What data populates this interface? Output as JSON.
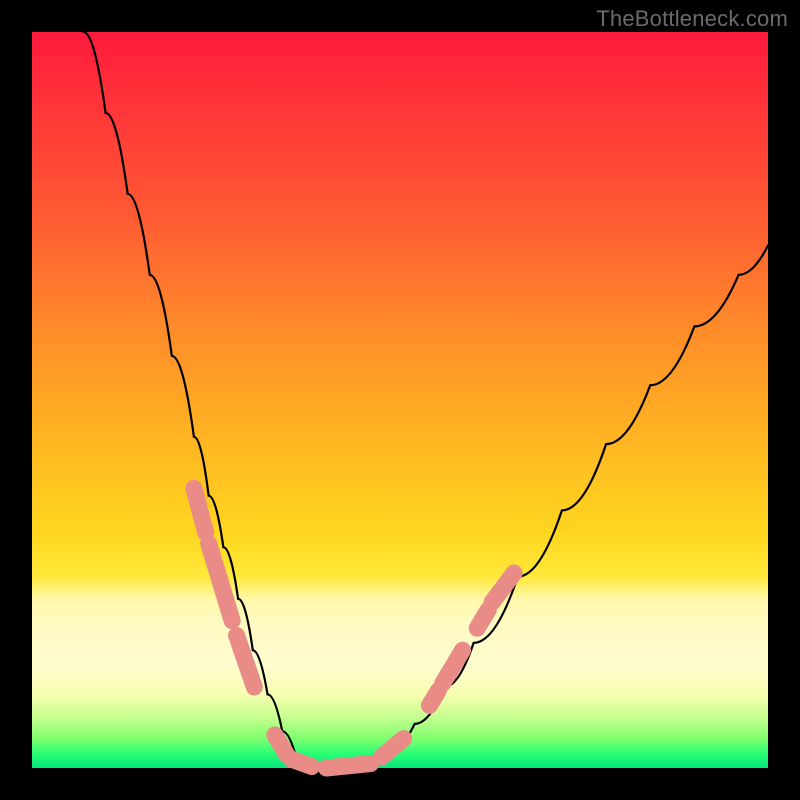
{
  "watermark": {
    "text": "TheBottleneck.com"
  },
  "chart_data": {
    "type": "line",
    "title": "",
    "xlabel": "",
    "ylabel": "",
    "xlim": [
      0,
      100
    ],
    "ylim": [
      0,
      100
    ],
    "grid": false,
    "legend": false,
    "series": [
      {
        "name": "bottleneck-curve",
        "x": [
          7,
          10,
          13,
          16,
          19,
          22,
          24,
          26,
          28,
          30,
          32,
          34,
          36,
          40,
          44,
          48,
          52,
          56,
          60,
          66,
          72,
          78,
          84,
          90,
          96,
          100
        ],
        "y": [
          100,
          89,
          78,
          67,
          56,
          45,
          37,
          30,
          23,
          16,
          10,
          5,
          1,
          0,
          0,
          2,
          6,
          11,
          17,
          26,
          35,
          44,
          52,
          60,
          67,
          71
        ]
      }
    ],
    "overlay_segments": {
      "name": "highlight-beads",
      "color": "#e98b87",
      "segments": [
        {
          "x": [
            22.0,
            23.6
          ],
          "y": [
            38.0,
            32.0
          ]
        },
        {
          "x": [
            24.0,
            27.2
          ],
          "y": [
            30.5,
            20.0
          ]
        },
        {
          "x": [
            27.8,
            30.2
          ],
          "y": [
            18.0,
            11.0
          ]
        },
        {
          "x": [
            33.0,
            34.6
          ],
          "y": [
            4.5,
            1.8
          ]
        },
        {
          "x": [
            35.2,
            38.0
          ],
          "y": [
            1.2,
            0.2
          ]
        },
        {
          "x": [
            40.0,
            46.0
          ],
          "y": [
            0.0,
            0.6
          ]
        },
        {
          "x": [
            47.5,
            50.5
          ],
          "y": [
            1.5,
            4.0
          ]
        },
        {
          "x": [
            54.0,
            55.2
          ],
          "y": [
            8.5,
            10.5
          ]
        },
        {
          "x": [
            55.8,
            58.5
          ],
          "y": [
            11.5,
            16.0
          ]
        },
        {
          "x": [
            60.5,
            62.0
          ],
          "y": [
            19.0,
            21.5
          ]
        },
        {
          "x": [
            62.5,
            65.5
          ],
          "y": [
            22.5,
            26.5
          ]
        }
      ]
    },
    "background_gradient": {
      "stops": [
        {
          "pos": 0.0,
          "color": "#ff1a3c"
        },
        {
          "pos": 0.25,
          "color": "#ff5a33"
        },
        {
          "pos": 0.55,
          "color": "#ffb422"
        },
        {
          "pos": 0.77,
          "color": "#fff7a8"
        },
        {
          "pos": 0.96,
          "color": "#7fff70"
        },
        {
          "pos": 1.0,
          "color": "#00e77a"
        }
      ]
    }
  }
}
